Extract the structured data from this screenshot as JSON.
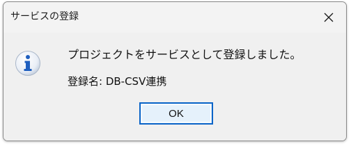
{
  "dialog": {
    "title": "サービスの登録",
    "close_icon": "close-icon",
    "icon": "info-icon",
    "message": "プロジェクトをサービスとして登録しました。",
    "service_name": "登録名: DB-CSV連携",
    "ok_label": "OK"
  },
  "colors": {
    "info_icon_blue": "#1f5fbf",
    "button_border": "#0a64c8",
    "button_fill": "#e5f1fb",
    "dialog_bg": "#f0f0f0"
  }
}
